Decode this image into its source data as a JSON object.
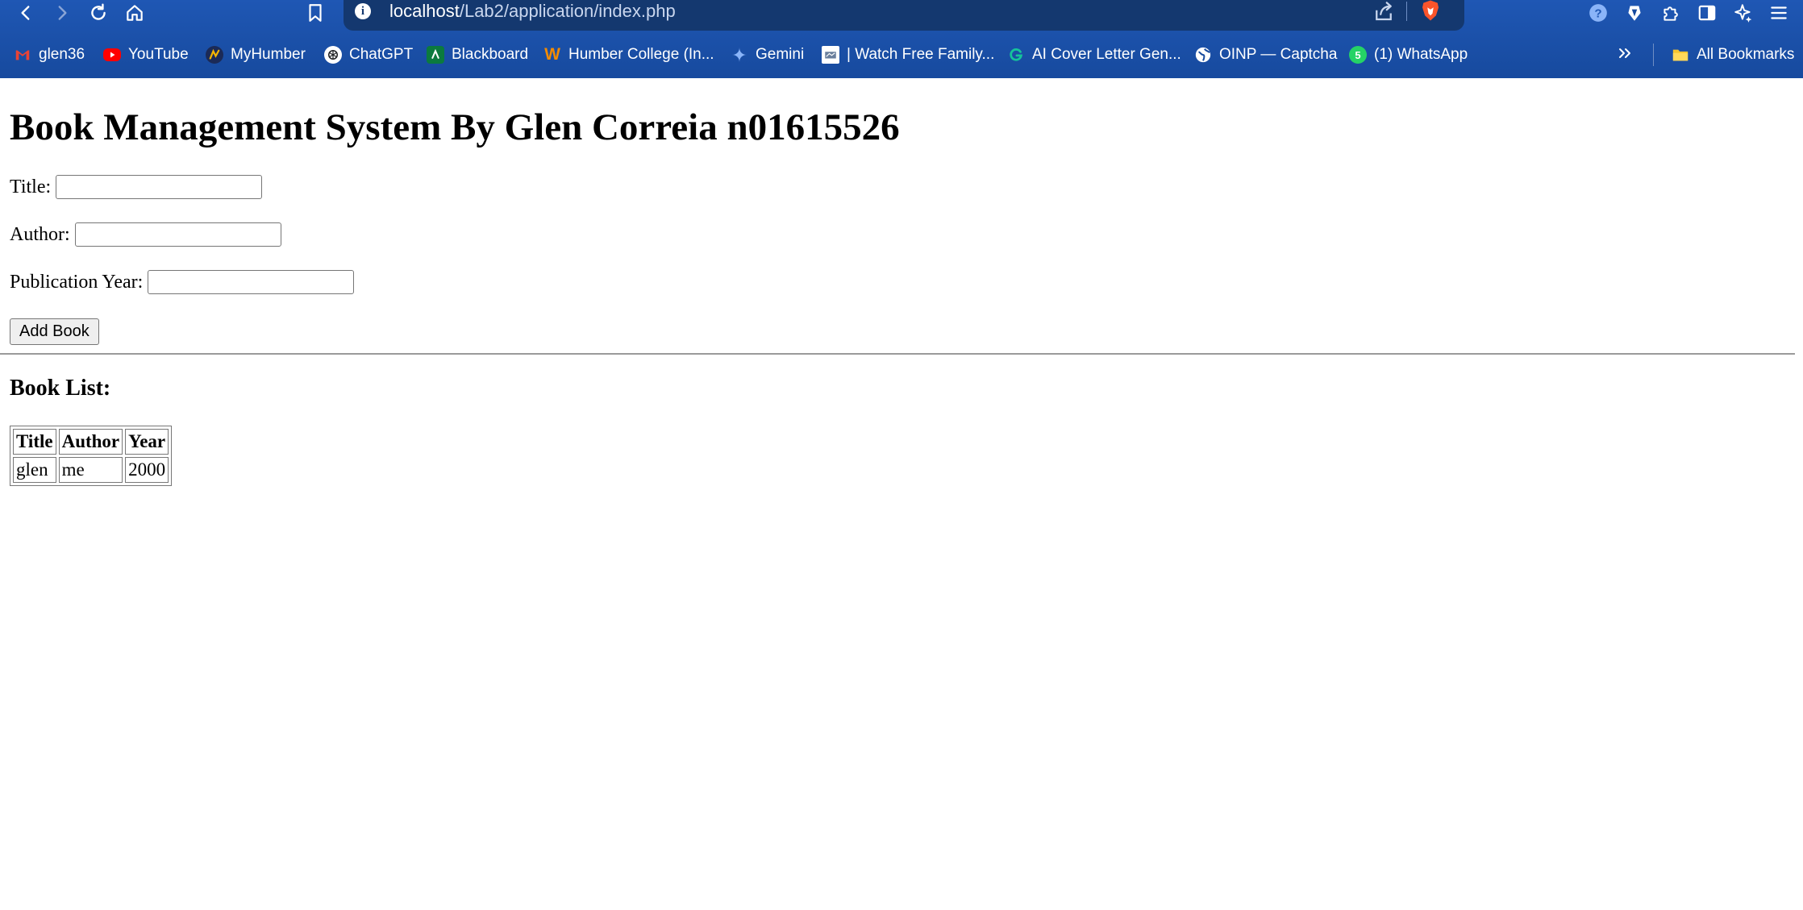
{
  "browser": {
    "url_host": "localhost",
    "url_path": "/Lab2/application/index.php",
    "bookmarks": [
      {
        "label": "glen36",
        "icon": "gmail-icon",
        "color": "#ea4335"
      },
      {
        "label": "YouTube",
        "icon": "youtube-icon",
        "color": "#ff0000"
      },
      {
        "label": "MyHumber",
        "icon": "myhumber-icon",
        "color": "#f4b400"
      },
      {
        "label": "ChatGPT",
        "icon": "chatgpt-icon",
        "color": "#ffffff"
      },
      {
        "label": "Blackboard",
        "icon": "blackboard-icon",
        "color": "#0f9d58"
      },
      {
        "label": "Humber College (In...",
        "icon": "workday-icon",
        "color": "#f38b00"
      },
      {
        "label": "Gemini",
        "icon": "gemini-icon",
        "color": "#8ab4f8"
      },
      {
        "label": "| Watch Free Family...",
        "icon": "tv-icon",
        "color": "#ffffff"
      },
      {
        "label": "AI Cover Letter Gen...",
        "icon": "grammarly-icon",
        "color": "#15c39a"
      },
      {
        "label": "OINP — Captcha",
        "icon": "globe-icon",
        "color": "#ffffff"
      },
      {
        "label": "(1) WhatsApp",
        "icon": "whatsapp-icon",
        "color": "#25d366"
      }
    ],
    "all_bookmarks_label": "All Bookmarks"
  },
  "page": {
    "heading": "Book Management System By Glen Correia n01615526",
    "form": {
      "title_label": "Title:",
      "author_label": "Author:",
      "year_label": "Publication Year:",
      "title_value": "",
      "author_value": "",
      "year_value": "",
      "submit_label": "Add Book"
    },
    "list_heading": "Book List:",
    "table": {
      "headers": [
        "Title",
        "Author",
        "Year"
      ],
      "rows": [
        [
          "glen",
          "me",
          "2000"
        ]
      ]
    }
  }
}
